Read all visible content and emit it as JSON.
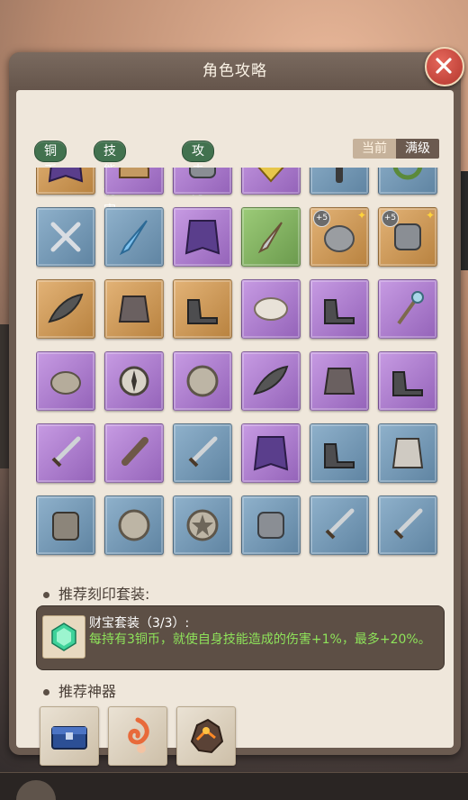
{
  "title": "角色攻略",
  "filter_tabs": [
    "铜币",
    "技能伤害",
    "攻击力"
  ],
  "level_toggle": {
    "current": "当前",
    "max": "满级"
  },
  "item_rows": [
    [
      {
        "rarity": "orange",
        "icon": "cape-icon"
      },
      {
        "rarity": "purple",
        "icon": "helmet-icon"
      },
      {
        "rarity": "purple",
        "icon": "gauntlet-icon"
      },
      {
        "rarity": "purple",
        "icon": "jewel-icon"
      },
      {
        "rarity": "blue",
        "icon": "rod-icon"
      },
      {
        "rarity": "blue",
        "icon": "wreath-icon"
      }
    ],
    [
      {
        "rarity": "blue",
        "icon": "double-blade-icon"
      },
      {
        "rarity": "blue",
        "icon": "crystal-dagger-icon"
      },
      {
        "rarity": "purple",
        "icon": "cape-icon"
      },
      {
        "rarity": "green",
        "icon": "dagger-icon"
      },
      {
        "rarity": "orange",
        "icon": "rock-armor-icon",
        "plus": "+5",
        "star": true
      },
      {
        "rarity": "orange",
        "icon": "gauntlet-icon",
        "plus": "+5",
        "star": true
      }
    ],
    [
      {
        "rarity": "orange",
        "icon": "wing-icon"
      },
      {
        "rarity": "orange",
        "icon": "armor-icon"
      },
      {
        "rarity": "orange",
        "icon": "boots-icon"
      },
      {
        "rarity": "purple",
        "icon": "fur-collar-icon"
      },
      {
        "rarity": "purple",
        "icon": "boots-icon"
      },
      {
        "rarity": "purple",
        "icon": "staff-icon"
      }
    ],
    [
      {
        "rarity": "purple",
        "icon": "piggy-bank-icon"
      },
      {
        "rarity": "purple",
        "icon": "compass-icon"
      },
      {
        "rarity": "purple",
        "icon": "coin-icon"
      },
      {
        "rarity": "purple",
        "icon": "wing-icon"
      },
      {
        "rarity": "purple",
        "icon": "armor-icon"
      },
      {
        "rarity": "purple",
        "icon": "boots-icon"
      }
    ],
    [
      {
        "rarity": "purple",
        "icon": "sword-icon"
      },
      {
        "rarity": "purple",
        "icon": "club-icon"
      },
      {
        "rarity": "blue",
        "icon": "sword-icon"
      },
      {
        "rarity": "purple",
        "icon": "cape-icon"
      },
      {
        "rarity": "blue",
        "icon": "boots-icon"
      },
      {
        "rarity": "blue",
        "icon": "vest-icon"
      }
    ],
    [
      {
        "rarity": "blue",
        "icon": "backpack-icon"
      },
      {
        "rarity": "blue",
        "icon": "coin-icon"
      },
      {
        "rarity": "blue",
        "icon": "star-coin-icon"
      },
      {
        "rarity": "blue",
        "icon": "gauntlet-icon"
      },
      {
        "rarity": "blue",
        "icon": "sword-icon"
      },
      {
        "rarity": "blue",
        "icon": "sword-icon"
      }
    ]
  ],
  "imprint_section": {
    "title": "推荐刻印套装:",
    "set_name": "财宝套装（3/3）:",
    "set_desc": "每持有3铜币，就使自身技能造成的伤害+1%，最多+20%。"
  },
  "artifact_section": {
    "title": "推荐神器",
    "artifacts": [
      {
        "icon": "treasure-chest-icon"
      },
      {
        "icon": "fire-swirl-icon"
      },
      {
        "icon": "lava-rock-icon"
      }
    ]
  },
  "colors": {
    "tab_green": "#42724f",
    "set_desc_green": "#8ee35a",
    "rarity_blue": "#6f93b1",
    "rarity_purple": "#a775c9",
    "rarity_orange": "#c9924f",
    "rarity_green": "#7dac5d"
  }
}
